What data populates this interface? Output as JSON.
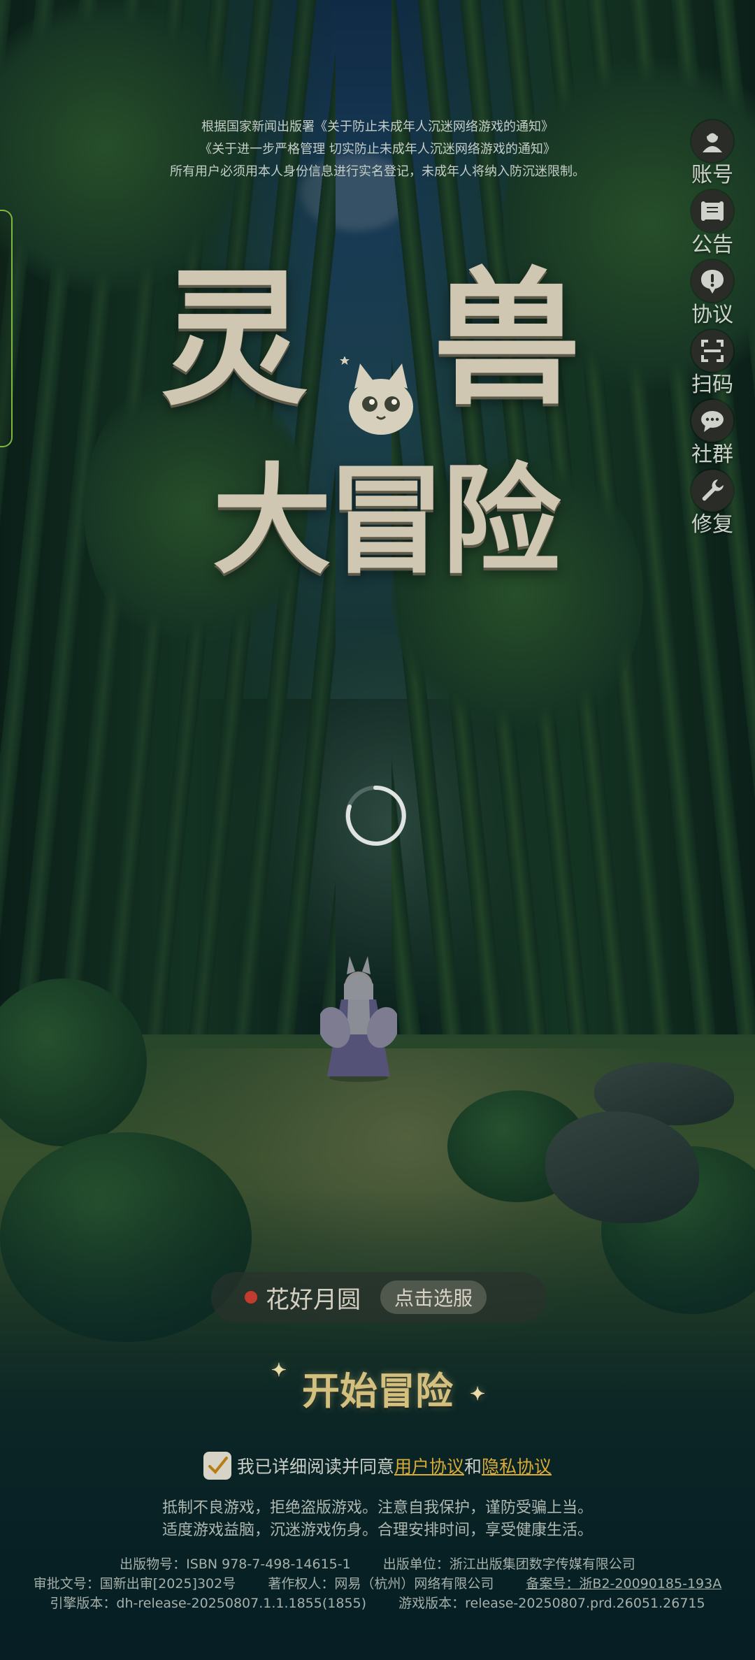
{
  "notice": {
    "line1": "根据国家新闻出版署《关于防止未成年人沉迷网络游戏的通知》",
    "line2": "《关于进一步严格管理 切实防止未成年人沉迷网络游戏的通知》",
    "line3": "所有用户必须用本人身份信息进行实名登记，未成年人将纳入防沉迷限制。"
  },
  "side_menu": [
    {
      "label": "账号",
      "icon": "account-icon"
    },
    {
      "label": "公告",
      "icon": "announcement-icon"
    },
    {
      "label": "协议",
      "icon": "agreement-icon"
    },
    {
      "label": "扫码",
      "icon": "scan-icon"
    },
    {
      "label": "社群",
      "icon": "community-icon"
    },
    {
      "label": "修复",
      "icon": "repair-icon"
    }
  ],
  "logo": {
    "line1_char1": "灵",
    "line1_char2": "兽",
    "line2": "大冒险"
  },
  "server": {
    "name": "花好月圆",
    "select_label": "点击选服"
  },
  "start_button": "开始冒险",
  "agreement": {
    "prefix": "我已详细阅读并同意",
    "user_agreement": "用户协议",
    "and": "和",
    "privacy_agreement": "隐私协议"
  },
  "health_notice": {
    "line1": "抵制不良游戏，拒绝盗版游戏。注意自我保护，谨防受骗上当。",
    "line2": "适度游戏益脑，沉迷游戏伤身。合理安排时间，享受健康生活。"
  },
  "legal": {
    "isbn": "出版物号：ISBN 978-7-498-14615-1",
    "publisher": "出版单位：浙江出版集团数字传媒有限公司",
    "approval": "审批文号：国新出审[2025]302号",
    "copyright": "著作权人：网易（杭州）网络有限公司",
    "icp": "备案号：浙B2-20090185-193A",
    "engine_version": "引擎版本：dh-release-20250807.1.1.1855(1855)",
    "game_version": "游戏版本：release-20250807.prd.26051.26715"
  },
  "colors": {
    "accent_gold": "#d8aa37",
    "server_dot": "#c33a2e",
    "tab_border": "#7fb83f"
  }
}
